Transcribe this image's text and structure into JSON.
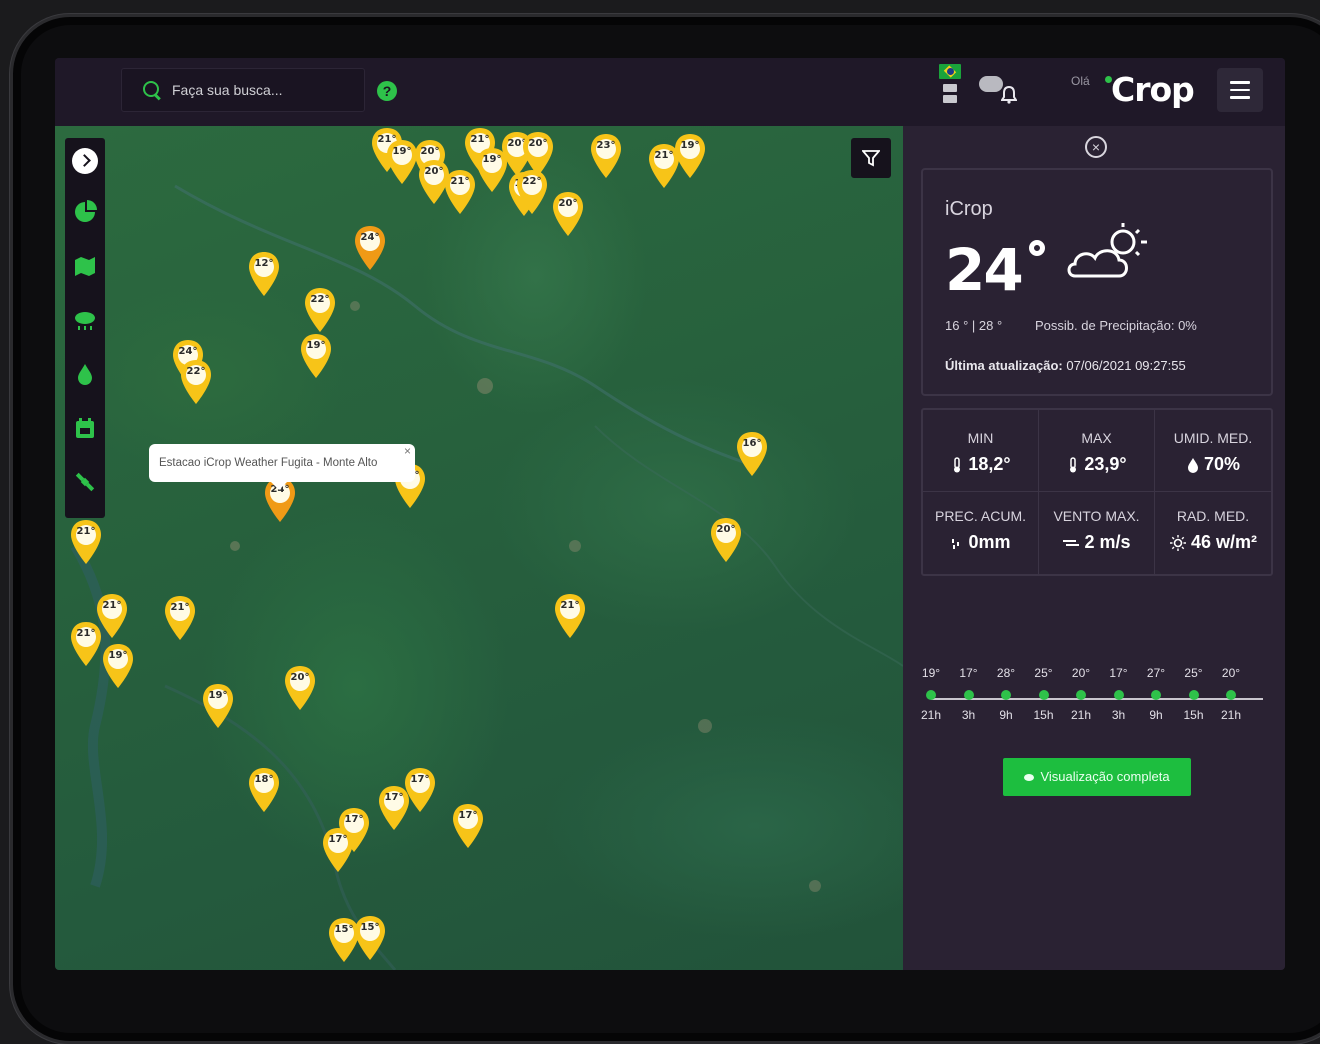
{
  "header": {
    "search_placeholder": "Faça sua busca...",
    "help_label": "?",
    "greeting": "Olá",
    "logo_text": "Crop"
  },
  "map": {
    "tooltip_text": "Estacao iCrop Weather Fugita - Monte Alto",
    "tooltip_close": "×",
    "pins": [
      {
        "label": "21°",
        "color": "yellow"
      },
      {
        "label": "19°",
        "color": "yellow"
      },
      {
        "label": "20°",
        "color": "yellow"
      },
      {
        "label": "20°",
        "color": "yellow"
      },
      {
        "label": "21°",
        "color": "yellow"
      },
      {
        "label": "19°",
        "color": "yellow"
      },
      {
        "label": "19°",
        "color": "yellow"
      },
      {
        "label": "22°",
        "color": "yellow"
      },
      {
        "label": "20°",
        "color": "yellow"
      },
      {
        "label": "23°",
        "color": "yellow"
      },
      {
        "label": "21°",
        "color": "yellow"
      },
      {
        "label": "19°",
        "color": "yellow"
      },
      {
        "label": "20°",
        "color": "yellow"
      },
      {
        "label": "21°",
        "color": "yellow"
      },
      {
        "label": "20°",
        "color": "yellow"
      },
      {
        "label": "24°",
        "color": "orange"
      },
      {
        "label": "12°",
        "color": "yellow"
      },
      {
        "label": "22°",
        "color": "yellow"
      },
      {
        "label": "19°",
        "color": "yellow"
      },
      {
        "label": "24°",
        "color": "yellow"
      },
      {
        "label": "22°",
        "color": "yellow"
      },
      {
        "label": "16°",
        "color": "yellow"
      },
      {
        "label": "24°",
        "color": "orange"
      },
      {
        "label": "21°",
        "color": "yellow"
      },
      {
        "label": "21°",
        "color": "yellow"
      },
      {
        "label": "20°",
        "color": "yellow"
      },
      {
        "label": "21°",
        "color": "yellow"
      },
      {
        "label": "21°",
        "color": "yellow"
      },
      {
        "label": "21°",
        "color": "yellow"
      },
      {
        "label": "19°",
        "color": "yellow"
      },
      {
        "label": "21°",
        "color": "yellow"
      },
      {
        "label": "20°",
        "color": "yellow"
      },
      {
        "label": "19°",
        "color": "yellow"
      },
      {
        "label": "18°",
        "color": "yellow"
      },
      {
        "label": "17°",
        "color": "yellow"
      },
      {
        "label": "17°",
        "color": "yellow"
      },
      {
        "label": "17°",
        "color": "yellow"
      },
      {
        "label": "17°",
        "color": "yellow"
      },
      {
        "label": "17°",
        "color": "yellow"
      },
      {
        "label": "15°",
        "color": "yellow"
      },
      {
        "label": "15°",
        "color": "yellow"
      }
    ]
  },
  "panel": {
    "close_label": "×",
    "station_name": "iCrop",
    "temperature": "24",
    "min_max": "16 ° | 28 °",
    "precip_chance": "Possib. de Precipitação: 0%",
    "updated_label": "Última atualização:",
    "updated_value": "07/06/2021 09:27:55",
    "stats": [
      {
        "label": "MIN",
        "value": "18,2°",
        "icon": "thermometer-icon"
      },
      {
        "label": "MAX",
        "value": "23,9°",
        "icon": "thermometer-icon"
      },
      {
        "label": "UMID. MED.",
        "value": "70%",
        "icon": "droplet-icon"
      },
      {
        "label": "PREC. ACUM.",
        "value": "0mm",
        "icon": "rain-icon"
      },
      {
        "label": "VENTO MAX.",
        "value": "2 m/s",
        "icon": "wind-icon"
      },
      {
        "label": "RAD. MED.",
        "value": "46 w/m²",
        "icon": "sun-icon"
      }
    ],
    "forecast": [
      {
        "temp": "19°",
        "hour": "21h"
      },
      {
        "temp": "17°",
        "hour": "3h"
      },
      {
        "temp": "28°",
        "hour": "9h"
      },
      {
        "temp": "25°",
        "hour": "15h"
      },
      {
        "temp": "20°",
        "hour": "21h"
      },
      {
        "temp": "17°",
        "hour": "3h"
      },
      {
        "temp": "27°",
        "hour": "9h"
      },
      {
        "temp": "25°",
        "hour": "15h"
      },
      {
        "temp": "20°",
        "hour": "21h"
      }
    ],
    "full_view_label": "Visualização completa"
  },
  "colors": {
    "accent": "#2ec24a",
    "pin_yellow": "#f7c418",
    "pin_orange": "#f09a16",
    "panel_bg": "#2a2233"
  }
}
